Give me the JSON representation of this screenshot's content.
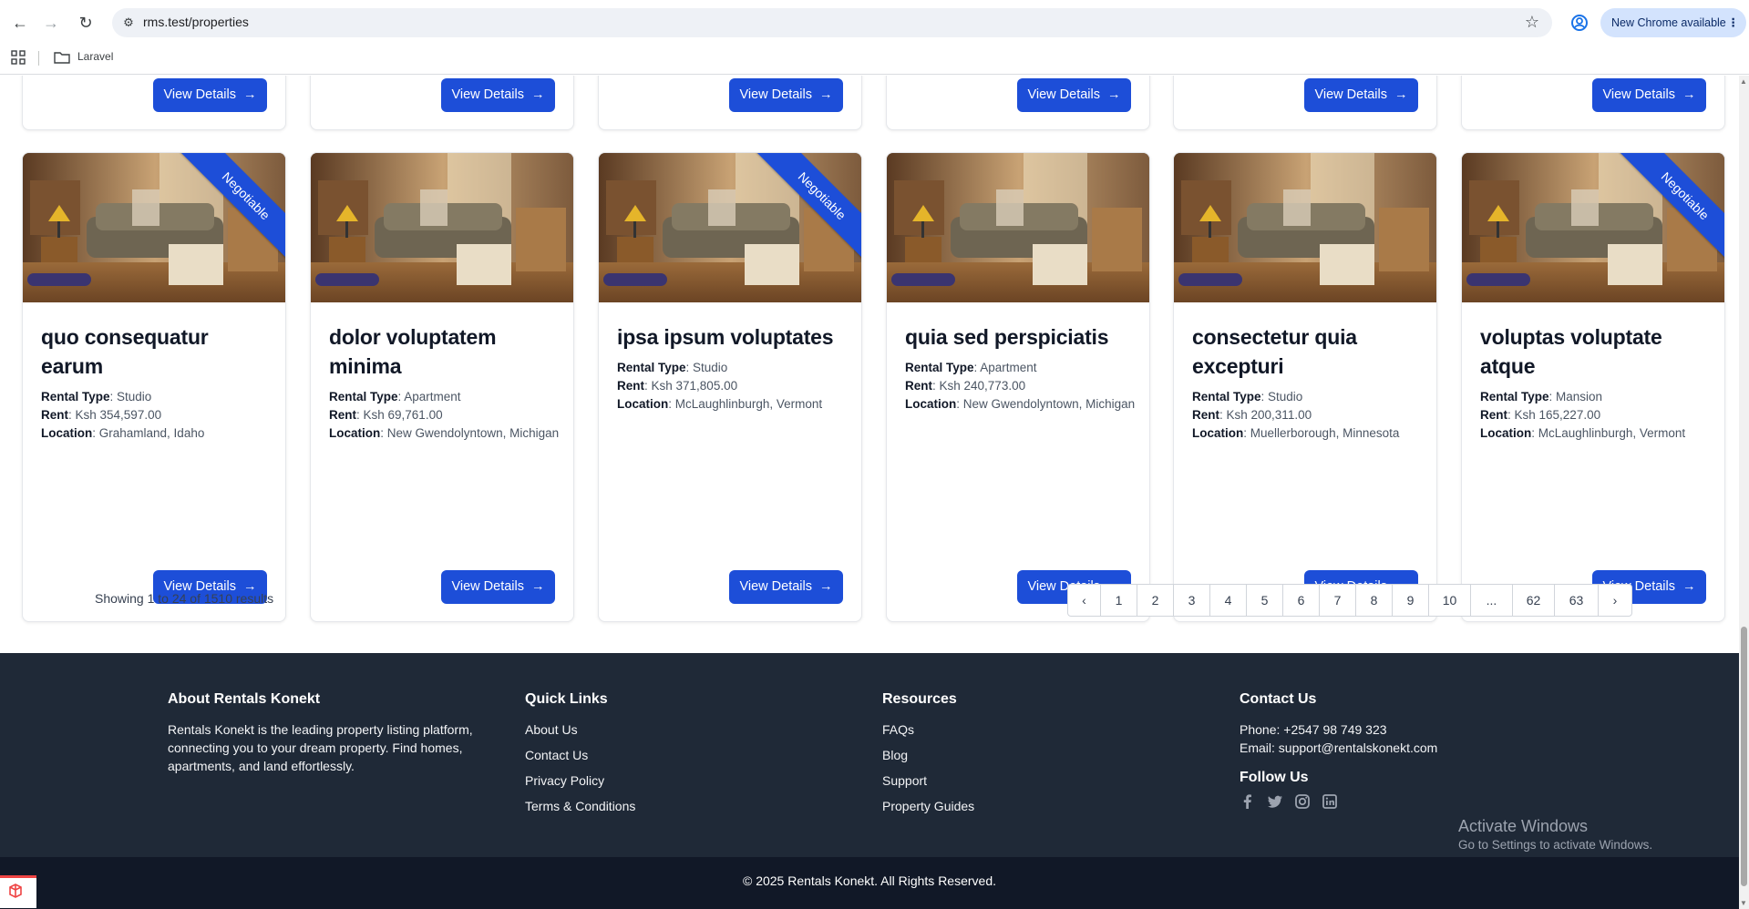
{
  "browser": {
    "url": "rms.test/properties",
    "update_pill": "New Chrome available",
    "bookmark_folder": "Laravel"
  },
  "cards_top": [
    {
      "button": "View Details"
    },
    {
      "button": "View Details"
    },
    {
      "button": "View Details"
    },
    {
      "button": "View Details"
    },
    {
      "button": "View Details"
    },
    {
      "button": "View Details"
    }
  ],
  "cards": [
    {
      "title": "quo consequatur earum",
      "negotiable": true,
      "rental_type_label": "Rental Type",
      "rental_type": "Studio",
      "rent_label": "Rent",
      "rent": "Ksh 354,597.00",
      "location_label": "Location",
      "location": "Grahamland, Idaho",
      "button": "View Details"
    },
    {
      "title": "dolor voluptatem minima",
      "negotiable": false,
      "rental_type_label": "Rental Type",
      "rental_type": "Apartment",
      "rent_label": "Rent",
      "rent": "Ksh 69,761.00",
      "location_label": "Location",
      "location": "New Gwendolyntown, Michigan",
      "button": "View Details"
    },
    {
      "title": "ipsa ipsum voluptates",
      "negotiable": true,
      "rental_type_label": "Rental Type",
      "rental_type": "Studio",
      "rent_label": "Rent",
      "rent": "Ksh 371,805.00",
      "location_label": "Location",
      "location": "McLaughlinburgh, Vermont",
      "button": "View Details"
    },
    {
      "title": "quia sed perspiciatis",
      "negotiable": false,
      "rental_type_label": "Rental Type",
      "rental_type": "Apartment",
      "rent_label": "Rent",
      "rent": "Ksh 240,773.00",
      "location_label": "Location",
      "location": "New Gwendolyntown, Michigan",
      "button": "View Details"
    },
    {
      "title": "consectetur quia excepturi",
      "negotiable": false,
      "rental_type_label": "Rental Type",
      "rental_type": "Studio",
      "rent_label": "Rent",
      "rent": "Ksh 200,311.00",
      "location_label": "Location",
      "location": "Muellerborough, Minnesota",
      "button": "View Details"
    },
    {
      "title": "voluptas voluptate atque",
      "negotiable": true,
      "rental_type_label": "Rental Type",
      "rental_type": "Mansion",
      "rent_label": "Rent",
      "rent": "Ksh 165,227.00",
      "location_label": "Location",
      "location": "McLaughlinburgh, Vermont",
      "button": "View Details"
    }
  ],
  "ribbon_text": "Negotiable",
  "pagination": {
    "showing": "Showing 1 to 24 of 1510 results",
    "pages": [
      "‹",
      "1",
      "2",
      "3",
      "4",
      "5",
      "6",
      "7",
      "8",
      "9",
      "10",
      "...",
      "62",
      "63",
      "›"
    ]
  },
  "footer": {
    "about": {
      "heading": "About Rentals Konekt",
      "text": "Rentals Konekt is the leading property listing platform, connecting you to your dream property. Find homes, apartments, and land effortlessly."
    },
    "quick_links": {
      "heading": "Quick Links",
      "items": [
        "About Us",
        "Contact Us",
        "Privacy Policy",
        "Terms & Conditions"
      ]
    },
    "resources": {
      "heading": "Resources",
      "items": [
        "FAQs",
        "Blog",
        "Support",
        "Property Guides"
      ]
    },
    "contact": {
      "heading": "Contact Us",
      "phone": "Phone: +2547 98 749 323",
      "email": "Email: support@rentalskonekt.com",
      "follow": "Follow Us",
      "socials": [
        "facebook-icon",
        "twitter-icon",
        "instagram-icon",
        "linkedin-icon"
      ]
    },
    "copyright": "© 2025 Rentals Konekt. All Rights Reserved."
  },
  "windows_watermark": {
    "line1": "Activate Windows",
    "line2": "Go to Settings to activate Windows."
  },
  "colors": {
    "primary": "#1d4ed8",
    "footer_bg": "#1f2937",
    "footer_bottom": "#111827"
  }
}
